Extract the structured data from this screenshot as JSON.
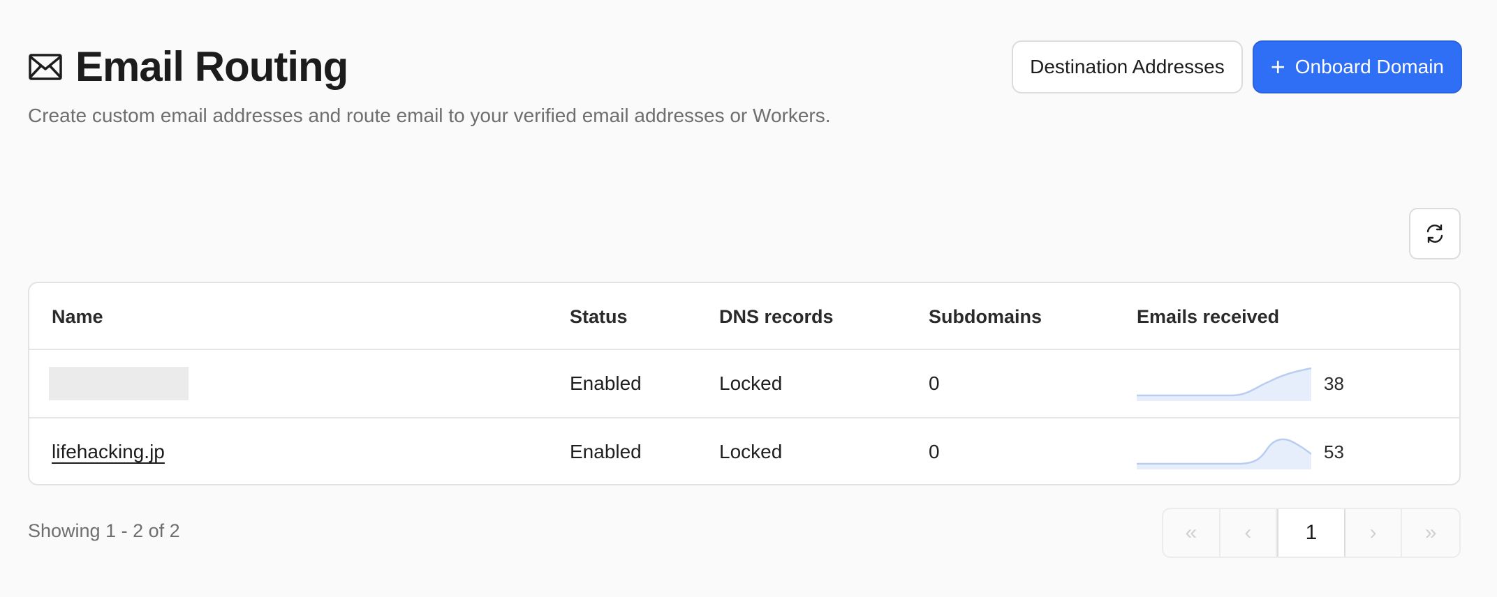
{
  "header": {
    "title": "Email Routing",
    "subtitle": "Create custom email addresses and route email to your verified email addresses or Workers.",
    "icon": "envelope-icon"
  },
  "actions": {
    "destination_label": "Destination Addresses",
    "onboard_label": "Onboard Domain",
    "onboard_icon": "plus-icon"
  },
  "colors": {
    "primary": "#2f6ff5",
    "sparkline_stroke": "#b9cdf0",
    "sparkline_fill": "#e6eefb"
  },
  "table": {
    "columns": [
      "Name",
      "Status",
      "DNS records",
      "Subdomains",
      "Emails received"
    ],
    "rows": [
      {
        "name": "",
        "redacted": true,
        "status": "Enabled",
        "dns": "Locked",
        "subdomains": "0",
        "emails": "38"
      },
      {
        "name": "lifehacking.jp",
        "redacted": false,
        "status": "Enabled",
        "dns": "Locked",
        "subdomains": "0",
        "emails": "53"
      }
    ]
  },
  "footer": {
    "showing": "Showing 1 - 2 of 2",
    "current_page": "1"
  }
}
